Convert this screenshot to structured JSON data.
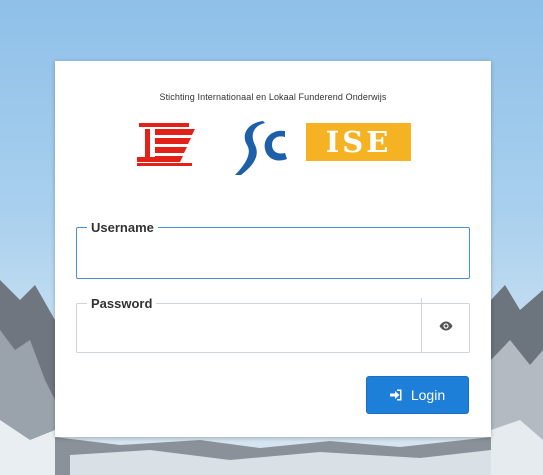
{
  "organization": {
    "name": "Stichting Internationaal en Lokaal Funderend Onderwijs"
  },
  "logos": [
    {
      "icon": "silfo-logo",
      "color": "#e32119"
    },
    {
      "icon": "sc-logo",
      "color": "#1d5fa8"
    },
    {
      "icon": "ise-logo",
      "text": "ISE",
      "color": "#f5b324"
    }
  ],
  "form": {
    "username": {
      "label": "Username",
      "value": "",
      "placeholder": ""
    },
    "password": {
      "label": "Password",
      "value": "",
      "placeholder": "",
      "toggle_icon": "eye-icon"
    },
    "login_button": {
      "label": "Login",
      "icon": "sign-in-icon",
      "color": "#1e7fd8"
    }
  }
}
